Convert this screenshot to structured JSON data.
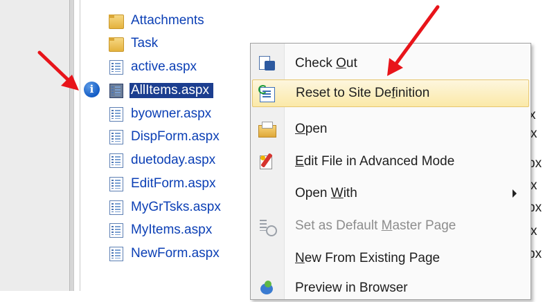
{
  "tree": {
    "items": [
      {
        "label": "Attachments",
        "icon": "folder-icon"
      },
      {
        "label": "Task",
        "icon": "folder-icon"
      },
      {
        "label": "active.aspx",
        "icon": "aspx-page-icon"
      },
      {
        "label": "AllItems.aspx",
        "icon": "aspx-page-icon",
        "selected": true
      },
      {
        "label": "byowner.aspx",
        "icon": "aspx-page-icon"
      },
      {
        "label": "DispForm.aspx",
        "icon": "aspx-page-icon"
      },
      {
        "label": "duetoday.aspx",
        "icon": "aspx-page-icon"
      },
      {
        "label": "EditForm.aspx",
        "icon": "aspx-page-icon"
      },
      {
        "label": "MyGrTsks.aspx",
        "icon": "aspx-page-icon"
      },
      {
        "label": "MyItems.aspx",
        "icon": "aspx-page-icon"
      },
      {
        "label": "NewForm.aspx",
        "icon": "aspx-page-icon"
      }
    ],
    "info_icon_glyph": "i"
  },
  "right_fragments": [
    "x",
    "x",
    "px",
    "px",
    "x",
    "px",
    "x",
    "px"
  ],
  "context_menu": {
    "items": [
      {
        "pre": "Check ",
        "accel": "O",
        "post": "ut",
        "icon": "check-out-icon"
      },
      {
        "pre": "Reset to Site De",
        "accel": "f",
        "post": "inition",
        "icon": "reset-site-definition-icon",
        "highlighted": true
      },
      {
        "pre": "",
        "accel": "O",
        "post": "pen",
        "icon": "open-folder-icon"
      },
      {
        "pre": "",
        "accel": "E",
        "post": "dit File in Advanced Mode",
        "icon": "edit-advanced-icon"
      },
      {
        "pre": "Open ",
        "accel": "W",
        "post": "ith",
        "icon": "",
        "submenu": true
      },
      {
        "pre": "Set as Default ",
        "accel": "M",
        "post": "aster Page",
        "icon": "master-page-icon",
        "disabled": true
      },
      {
        "pre": "",
        "accel": "N",
        "post": "ew From Existing Page",
        "icon": ""
      },
      {
        "pre": "Preview in Browser",
        "accel": "",
        "post": "",
        "icon": "preview-browser-icon"
      }
    ]
  },
  "colors": {
    "link_blue": "#0b3fb5",
    "selection": "#1c3e8f",
    "menu_highlight": "#fbe9a8",
    "annotation_arrow": "#e8141a"
  }
}
